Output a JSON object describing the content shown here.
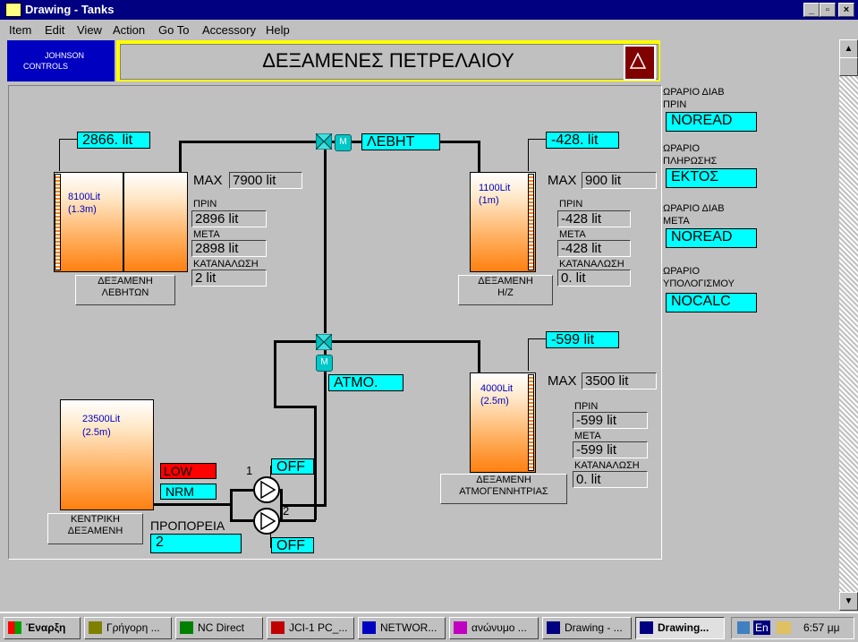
{
  "window": {
    "title": "Drawing - Tanks"
  },
  "menu": [
    "Item",
    "Edit",
    "View",
    "Action",
    "Go To",
    "Accessory",
    "Help"
  ],
  "logo": {
    "line1": "JOHNSON",
    "line2": "CONTROLS"
  },
  "banner": {
    "title": "ΔΕΞΑΜΕΝΕΣ ΠΕΤΡΕΛΑΙΟΥ"
  },
  "boiler_tank": {
    "reading": "2866. lit",
    "capacity": "8100Lit",
    "height": "(1.3m)",
    "caption_line1": "ΔΕΞΑΜΕΝΗ",
    "caption_line2": "ΛΕΒΗΤΩΝ",
    "max_label": "MAX",
    "max_value": "7900 lit",
    "before_label": "ΠΡΙΝ",
    "before_value": "2896 lit",
    "after_label": "ΜΕΤΑ",
    "after_value": "2898 lit",
    "consumption_label": "ΚΑΤΑΝΑΛΩΣΗ",
    "consumption_value": "2 lit"
  },
  "hz_tank": {
    "reading": "-428. lit",
    "capacity": "1100Lit",
    "height": "(1m)",
    "caption_line1": "ΔΕΞΑΜΕΝΗ",
    "caption_line2": "Η/Ζ",
    "max_label": "MAX",
    "max_value": "900 lit",
    "before_label": "ΠΡΙΝ",
    "before_value": "-428 lit",
    "after_label": "ΜΕΤΑ",
    "after_value": "-428 lit",
    "consumption_label": "ΚΑΤΑΝΑΛΩΣΗ",
    "consumption_value": "0. lit"
  },
  "steam_tank": {
    "reading": "-599 lit",
    "capacity": "4000Lit",
    "height": "(2.5m)",
    "caption_line1": "ΔΕΞΑΜΕΝΗ",
    "caption_line2": "ΑΤΜΟΓΕΝΝΗΤΡΙΑΣ",
    "max_label": "MAX",
    "max_value": "3500 lit",
    "before_label": "ΠΡΙΝ",
    "before_value": "-599 lit",
    "after_label": "ΜΕΤΑ",
    "after_value": "-599 lit",
    "consumption_label": "ΚΑΤΑΝΑΛΩΣΗ",
    "consumption_value": "0. lit"
  },
  "main_tank": {
    "capacity": "23500Lit",
    "height": "(2.5m)",
    "caption_line1": "ΚΕΝΤΡΙΚΗ",
    "caption_line2": "ΔΕΞΑΜΕΝΗ",
    "low_label": "LOW",
    "nrm_label": "NRM",
    "preheat_label": "ΠΡΟΠΟΡΕΙΑ",
    "preheat_value": "2"
  },
  "valves": {
    "boiler_label": "ΛΕΒΗΤ",
    "steam_label": "ΑΤΜΟ.",
    "motor_m": "M"
  },
  "pumps": {
    "pump1_num": "1",
    "pump1_state": "OFF",
    "pump2_num": "2",
    "pump2_state": "OFF"
  },
  "schedule": {
    "read_before_label1": "ΩΡΑΡΙΟ ΔΙΑΒ",
    "read_before_label2": "ΠΡΙΝ",
    "read_before_value": "NOREAD",
    "fill_label1": "ΩΡΑΡΙΟ",
    "fill_label2": "ΠΛΗΡΩΣΗΣ",
    "fill_value": "ΕΚΤΟΣ",
    "read_after_label1": "ΩΡΑΡΙΟ ΔΙΑΒ",
    "read_after_label2": "ΜΕΤΑ",
    "read_after_value": "NOREAD",
    "calc_label1": "ΩΡΑΡΙΟ",
    "calc_label2": "ΥΠΟΛΟΓΙΣΜΟΥ",
    "calc_value": "NOCALC"
  },
  "taskbar": {
    "start": "Έναρξη",
    "buttons": [
      "Γρήγορη ...",
      "NC Direct",
      "JCI-1 PC_...",
      "NETWOR...",
      "ανώνυμο ...",
      "Drawing - ...",
      "Drawing..."
    ],
    "lang": "En",
    "clock": "6:57 μμ"
  },
  "colors": {
    "title_bar": "#000080",
    "tank_fill": "#ff8010",
    "readout": "#00ffff",
    "alarm_low": "#ff0000"
  }
}
